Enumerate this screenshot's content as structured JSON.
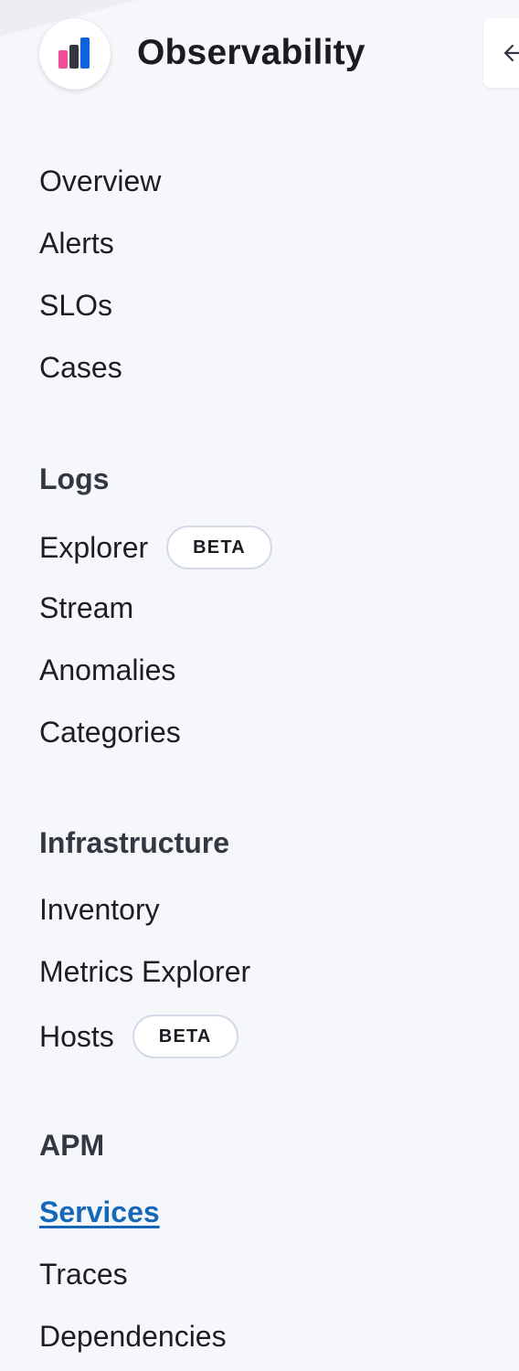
{
  "header": {
    "app_title": "Observability",
    "logo_icon": "observability-bar-chart-icon",
    "collapse_icon": "arrow-left-icon",
    "logo_colors": [
      "#f04e98",
      "#343741",
      "#0b64dd"
    ]
  },
  "nav": {
    "top_items": [
      {
        "label": "Overview"
      },
      {
        "label": "Alerts"
      },
      {
        "label": "SLOs"
      },
      {
        "label": "Cases"
      }
    ],
    "sections": [
      {
        "title": "Logs",
        "items": [
          {
            "label": "Explorer",
            "badge": "BETA"
          },
          {
            "label": "Stream"
          },
          {
            "label": "Anomalies"
          },
          {
            "label": "Categories"
          }
        ]
      },
      {
        "title": "Infrastructure",
        "items": [
          {
            "label": "Inventory"
          },
          {
            "label": "Metrics Explorer"
          },
          {
            "label": "Hosts",
            "badge": "BETA"
          }
        ]
      },
      {
        "title": "APM",
        "items": [
          {
            "label": "Services",
            "active": true
          },
          {
            "label": "Traces"
          },
          {
            "label": "Dependencies"
          }
        ]
      }
    ]
  },
  "colors": {
    "background": "#f6f7fb",
    "active_link": "#1567b8",
    "text": "#1c1e23",
    "section_title": "#343741"
  }
}
